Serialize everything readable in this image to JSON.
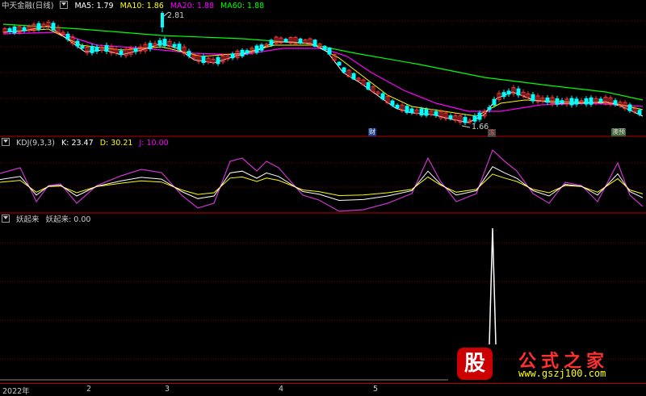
{
  "main": {
    "title": "中天金融(日线)",
    "ma5": "MA5: 1.79",
    "ma10": "MA10: 1.86",
    "ma20": "MA20: 1.88",
    "ma60": "MA60: 1.88",
    "colors": {
      "ma5": "#ffffff",
      "ma10": "#ffff00",
      "ma20": "#ff00ff",
      "ma60": "#00ff00",
      "up": "#ff3333",
      "down": "#00ffff"
    },
    "high_label": "2.81",
    "low_label": "1.66",
    "markers": [
      {
        "text": "财"
      },
      {
        "text": "冻"
      },
      {
        "text": "澳预"
      }
    ]
  },
  "kdj": {
    "name": "KDJ(9,3,3)",
    "k": "K: 23.47",
    "d": "D: 30.21",
    "j": "J: 10.00"
  },
  "yqm": {
    "name": "妖起来",
    "value": "妖起来: 0.00"
  },
  "xaxis": {
    "labels": [
      "2022年",
      "2",
      "3",
      "4",
      "5"
    ]
  },
  "watermark": {
    "logo": "股",
    "name": "公式之家",
    "url": "www.gszj100.com"
  }
}
